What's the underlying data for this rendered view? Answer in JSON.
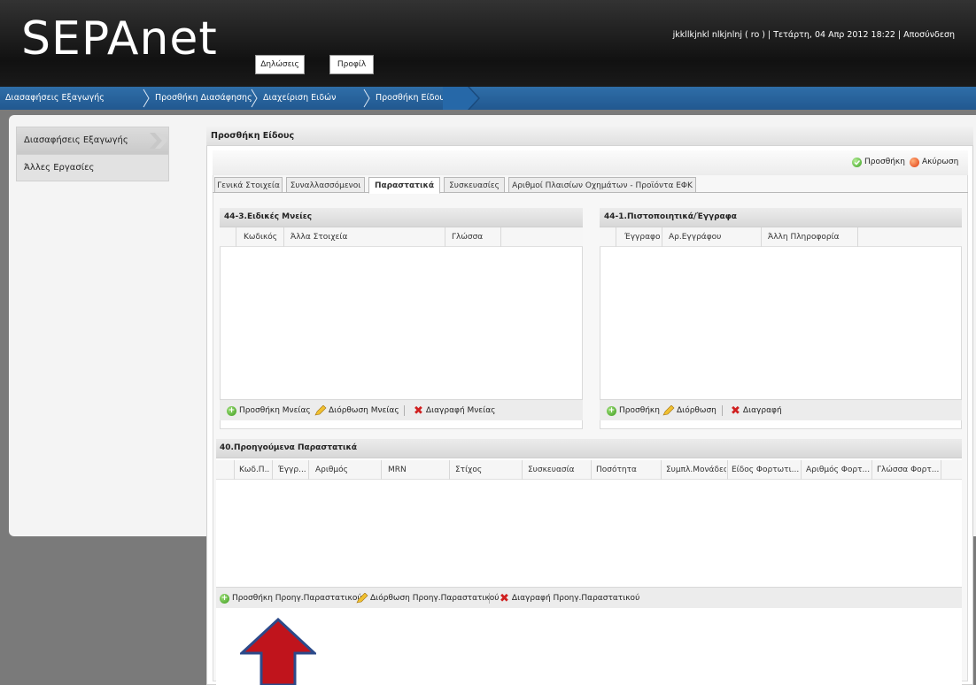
{
  "app": {
    "logo": "SEPAnet",
    "accent": "#2a66a0"
  },
  "header": {
    "nav_declarations": "Δηλώσεις",
    "nav_profile": "Προφίλ",
    "user_info": "jkkllkjnkl nlkjnlnj ( ro ) | Τετάρτη, 04 Απρ 2012 18:22 | Αποσύνδεση"
  },
  "breadcrumb": [
    "Διασαφήσεις Εξαγωγής",
    "Προσθήκη Διασάφησης",
    "Διαχείριση Ειδών",
    "Προσθήκη Είδους"
  ],
  "sidebar": {
    "items": [
      "Διασαφήσεις Εξαγωγής",
      "Άλλες Εργασίες"
    ]
  },
  "page": {
    "title": "Προσθήκη Είδους",
    "add_label": "Προσθήκη",
    "cancel_label": "Ακύρωση"
  },
  "tabs": [
    "Γενικά Στοιχεία",
    "Συναλλασσόμενοι",
    "Παραστατικά",
    "Συσκευασίες",
    "Αριθμοί Πλαισίων Οχημάτων - Προϊόντα ΕΦΚ"
  ],
  "active_tab": "Παραστατικά",
  "special_mentions": {
    "title": "44-3.Ειδικές Μνείες",
    "columns": [
      "Κωδικός",
      "Άλλα Στοιχεία",
      "Γλώσσα"
    ],
    "add": "Προσθήκη Μνείας",
    "edit": "Διόρθωση Μνείας",
    "delete": "Διαγραφή Μνείας"
  },
  "certificates": {
    "title": "44-1.Πιστοποιητικά/Έγγραφα",
    "columns": [
      "Έγγραφο",
      "Αρ.Εγγράφου",
      "Άλλη Πληροφορία"
    ],
    "add": "Προσθήκη",
    "edit": "Διόρθωση",
    "delete": "Διαγραφή"
  },
  "previous_docs": {
    "title": "40.Προηγούμενα Παραστατικά",
    "columns": [
      "Κωδ.Π...",
      "Έγγρ...",
      "Αριθμός",
      "MRN",
      "Στίχος",
      "Συσκευασία",
      "Ποσότητα",
      "Συμπλ.Μονάδες",
      "Είδος Φορτωτι...",
      "Αριθμός Φορτ...",
      "Γλώσσα Φορτ..."
    ],
    "add": "Προσθήκη Προηγ.Παραστατικού",
    "edit": "Διόρθωση Προηγ.Παραστατικού",
    "delete": "Διαγραφή Προηγ.Παραστατικού"
  },
  "annotation": {
    "arrow_icon": "up-arrow-icon",
    "arrow_color": "#c0141c",
    "arrow_outline": "#2c4a8a"
  }
}
